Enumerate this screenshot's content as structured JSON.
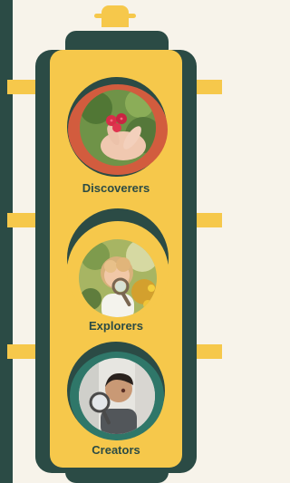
{
  "traffic_light": {
    "colors": {
      "background": "#f7f3ea",
      "housing": "#2b4b45",
      "panel": "#f6c84b",
      "ring_top": "#d25c3e",
      "ring_bottom": "#2f7769"
    },
    "lights": [
      {
        "label": "Discoverers",
        "image": "raspberries-in-hand-photo"
      },
      {
        "label": "Explorers",
        "image": "child-with-magnifying-glass-photo"
      },
      {
        "label": "Creators",
        "image": "boy-with-magnifying-glass-photo"
      }
    ]
  }
}
